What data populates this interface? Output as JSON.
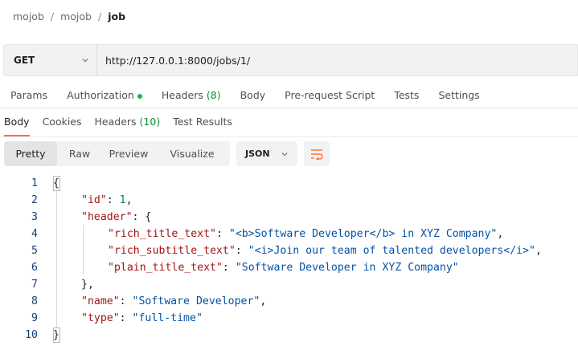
{
  "breadcrumb": {
    "items": [
      "mojob",
      "mojob"
    ],
    "current": "job",
    "separator": "/"
  },
  "request": {
    "method": "GET",
    "url": "http://127.0.0.1:8000/jobs/1/"
  },
  "request_tabs": [
    {
      "label": "Params"
    },
    {
      "label": "Authorization"
    },
    {
      "label": "Headers",
      "count": "(8)"
    },
    {
      "label": "Body"
    },
    {
      "label": "Pre-request Script"
    },
    {
      "label": "Tests"
    },
    {
      "label": "Settings"
    }
  ],
  "response_tabs": [
    {
      "label": "Body"
    },
    {
      "label": "Cookies"
    },
    {
      "label": "Headers",
      "count": "(10)"
    },
    {
      "label": "Test Results"
    }
  ],
  "format": {
    "options": [
      "Pretty",
      "Raw",
      "Preview",
      "Visualize"
    ],
    "selected": "Pretty",
    "language": "JSON"
  },
  "code_lines": [
    "{",
    "\"id\": 1,",
    "\"header\": {",
    "\"rich_title_text\": \"<b>Software Developer</b> in XYZ Company\",",
    "\"rich_subtitle_text\": \"<i>Join our team of talented developers</i>\",",
    "\"plain_title_text\": \"Software Developer in XYZ Company\"",
    "},",
    "\"name\": \"Software Developer\",",
    "\"type\": \"full-time\"",
    "}"
  ],
  "response_json": {
    "id": "1",
    "rich_title_text": "<b>Software Developer</b> in XYZ Company",
    "rich_subtitle_text": "<i>Join our team of talented developers</i>",
    "plain_title_text": "Software Developer in XYZ Company",
    "name": "Software Developer",
    "type": "full-time"
  },
  "line_numbers": [
    "1",
    "2",
    "3",
    "4",
    "5",
    "6",
    "7",
    "8",
    "9",
    "10"
  ],
  "colors": {
    "accent": "#ff6c37",
    "success": "#0cbb52",
    "count": "#0f8a3a",
    "key": "#a31515",
    "string": "#0451a5",
    "number": "#098658"
  }
}
